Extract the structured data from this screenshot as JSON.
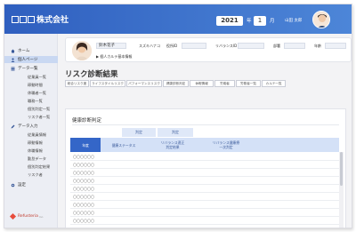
{
  "header": {
    "company_name": "株式会社",
    "year": "2021",
    "year_unit": "年",
    "month": "1",
    "month_unit": "月",
    "user_name": "山田 太郎"
  },
  "sidebar": {
    "items": [
      {
        "label": "ホーム"
      },
      {
        "label": "個人ページ"
      },
      {
        "label": "データ一覧"
      },
      {
        "label": "データ入力"
      },
      {
        "label": "設定"
      }
    ],
    "data_list_sub": [
      "従業員一覧",
      "稼動時間",
      "休職者一覧",
      "職務一覧",
      "個別判定一覧",
      "リスク者一覧"
    ],
    "data_input_sub": [
      "従業員情報",
      "稼動情報",
      "休職情報",
      "勤怠データ",
      "個別判定結果",
      "リスク者"
    ],
    "brand": "Refusteria",
    "brand_suffix": "Inc."
  },
  "profile": {
    "name": "鈴木花子",
    "name_kana": "スズキハナコ",
    "label_position": "役所ID",
    "label_revelance_id": "リバランスID",
    "label_dept": "部署",
    "label_age": "年齢",
    "link_text": "個人カルテ基本情報"
  },
  "page": {
    "title": "リスク診断結果",
    "tabs": [
      "総合リスク度",
      "ライフスタイルリスク",
      "パフォーマンスリスク",
      "健康診断判定",
      "休暇情報",
      "労働者",
      "労務者一覧",
      "カルテ一覧"
    ]
  },
  "panel": {
    "title": "健康診断判定",
    "group_headers": [
      "判定",
      "判定"
    ],
    "columns": [
      "年度",
      "健康ステータス",
      "リバランス適正\n判定結果",
      "リバランス健康療\n一次判定"
    ],
    "rows": [
      "〇〇〇〇〇〇",
      "〇〇〇〇〇〇",
      "〇〇〇〇〇〇",
      "〇〇〇〇〇〇",
      "〇〇〇〇〇〇",
      "〇〇〇〇〇〇",
      "〇〇〇〇〇〇",
      "〇〇〇〇〇〇",
      "〇〇〇〇〇〇"
    ]
  },
  "colors": {
    "header_start": "#2f5fbf",
    "header_end": "#4d86d8",
    "accent": "#3466c8",
    "sidebar_bg": "#eceef4",
    "table_header": "#d4e1f7"
  }
}
